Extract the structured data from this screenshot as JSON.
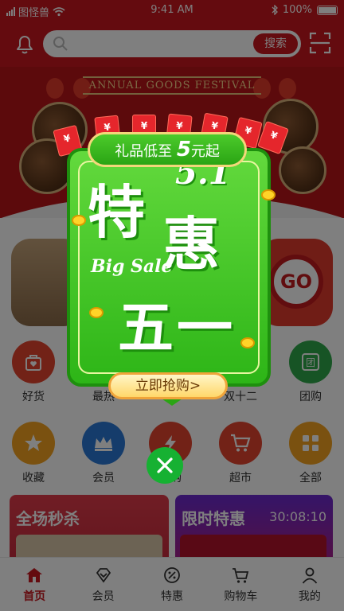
{
  "status_bar": {
    "carrier": "图怪兽",
    "time": "9:41 AM",
    "battery": "100%"
  },
  "search": {
    "placeholder": "",
    "button_label": "搜索"
  },
  "banner": {
    "festival_text": "ANNUAL GOODS FESTIVAL"
  },
  "categories_row1": [
    {
      "label": "好货",
      "icon": "bag-heart-icon",
      "color": "#e4452e"
    },
    {
      "label": "最热",
      "icon": "hot-icon",
      "color": "#f2a11f"
    },
    {
      "label": "双十二",
      "icon": "calendar-icon",
      "color": "#e4452e"
    },
    {
      "label": "团购",
      "icon": "group-icon",
      "color": "#2ea84a"
    }
  ],
  "categories_row2": [
    {
      "label": "收藏",
      "icon": "star-icon",
      "color": "#f4a321"
    },
    {
      "label": "会员",
      "icon": "crown-icon",
      "color": "#2a78d6"
    },
    {
      "label": "闪购",
      "icon": "lightning-icon",
      "color": "#e4452e"
    },
    {
      "label": "超市",
      "icon": "cart-icon",
      "color": "#e4452e"
    },
    {
      "label": "全部",
      "icon": "grid-icon",
      "color": "#f4a321"
    }
  ],
  "promo_cards": {
    "left_title": "全场秒杀",
    "right_title": "限时特惠",
    "countdown": "30:08:10"
  },
  "tabbar": [
    {
      "label": "首页",
      "icon": "home-icon",
      "active": true
    },
    {
      "label": "会员",
      "icon": "diamond-icon",
      "active": false
    },
    {
      "label": "特惠",
      "icon": "discount-icon",
      "active": false
    },
    {
      "label": "购物车",
      "icon": "cart-icon",
      "active": false
    },
    {
      "label": "我的",
      "icon": "user-icon",
      "active": false
    }
  ],
  "popup": {
    "ribbon_prefix": "礼品低至",
    "ribbon_number": "5",
    "ribbon_suffix": "元起",
    "headline_te": "特",
    "headline_hui": "惠",
    "headline_date": "5.1",
    "headline_bigsale": "Big Sale",
    "headline_wuyi": "五一",
    "cta_label": "立即抢购>"
  },
  "colors": {
    "brand_red": "#c8171e",
    "popup_green": "#2db517",
    "close_green": "#16b132"
  }
}
